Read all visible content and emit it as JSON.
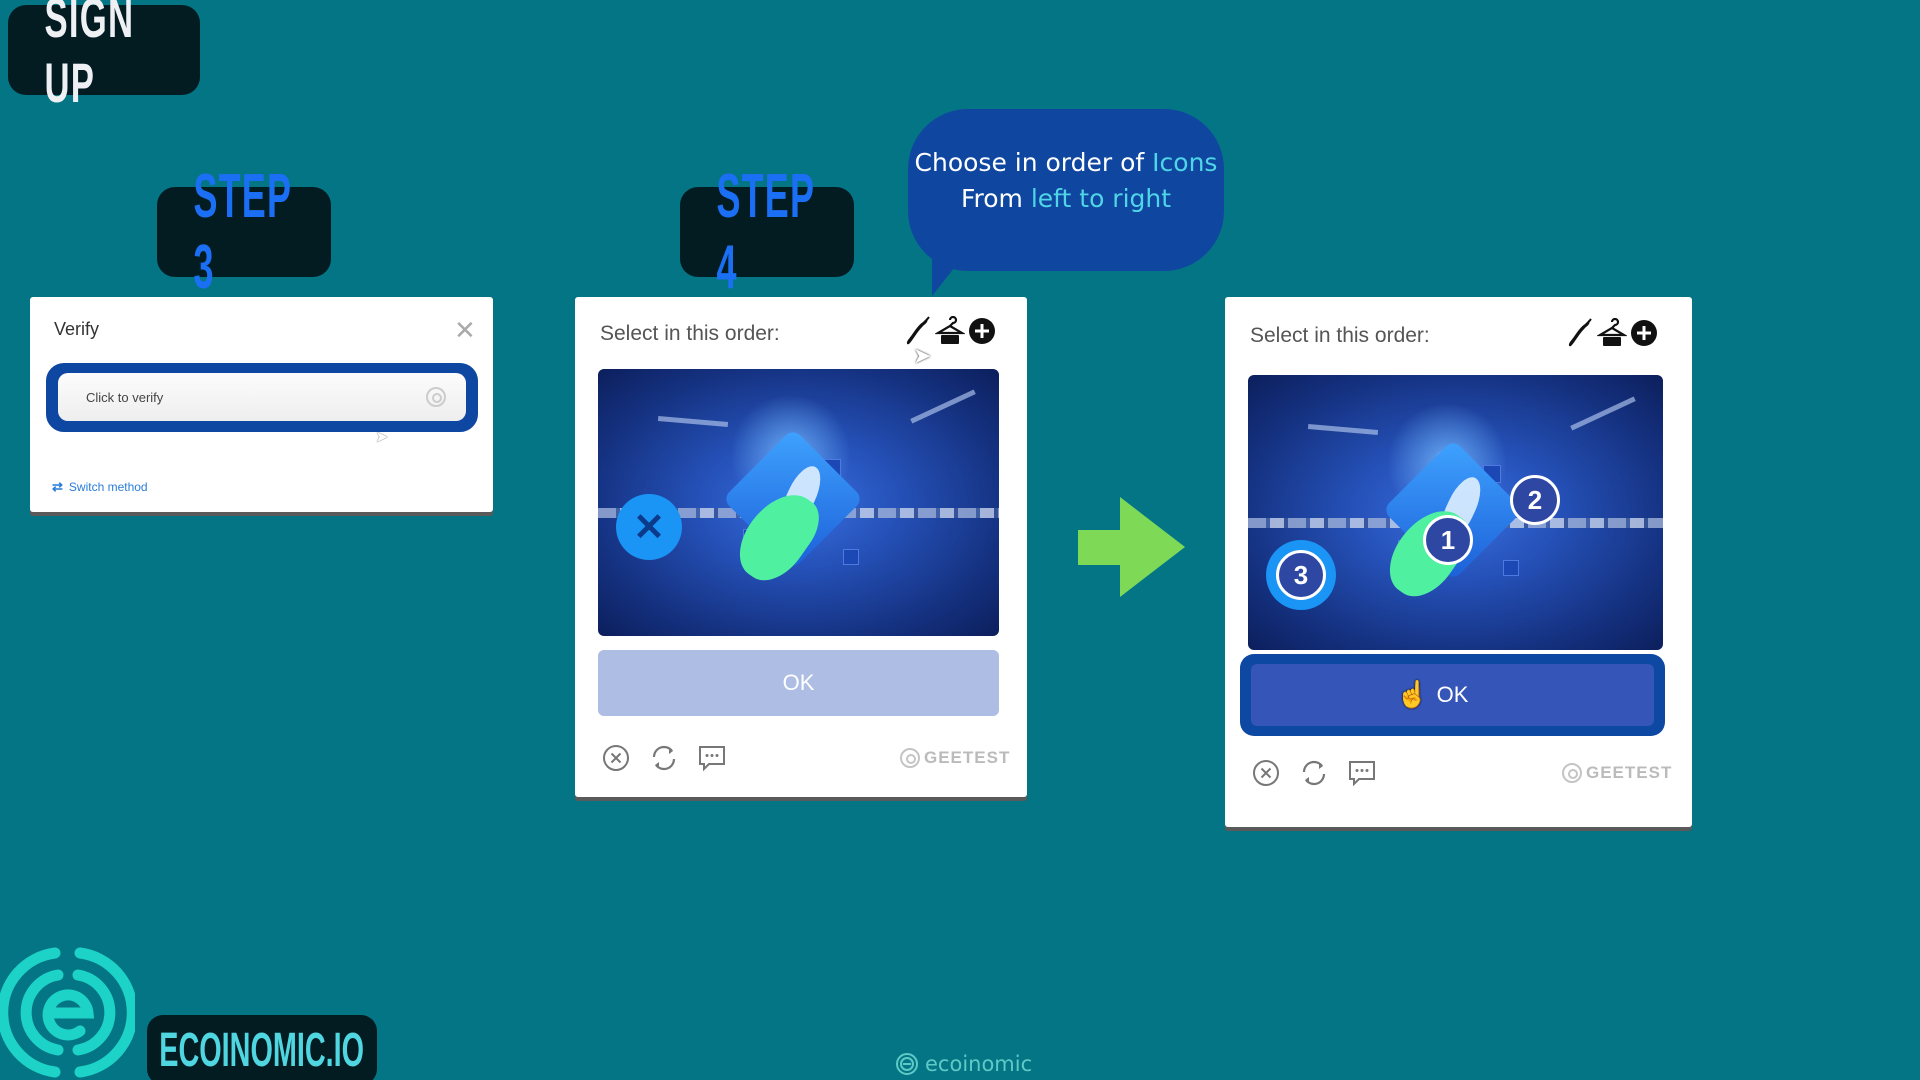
{
  "header": {
    "title": "SIGN UP"
  },
  "steps": [
    {
      "label": "STEP 3"
    },
    {
      "label": "STEP 4"
    }
  ],
  "tooltip": {
    "line1_text": "Choose in order of ",
    "line1_highlight": "Icons",
    "line2_text": "From ",
    "line2_highlight": "left to right"
  },
  "verify_dialog": {
    "title": "Verify",
    "close_icon": "close-icon",
    "field_label": "Click to verify",
    "switch_method": "Switch method"
  },
  "captcha_before": {
    "instruction": "Select in this order:",
    "icons": [
      "chili-pepper-icon",
      "hanger-icon",
      "plus-circle-icon"
    ],
    "ok_label": "OK",
    "ok_state": "disabled",
    "brand": "GEETEST"
  },
  "captcha_after": {
    "instruction": "Select in this order:",
    "icons": [
      "chili-pepper-icon",
      "hanger-icon",
      "plus-circle-icon"
    ],
    "markers": [
      "1",
      "2",
      "3"
    ],
    "ok_label": "OK",
    "ok_state": "active",
    "brand": "GEETEST"
  },
  "brand": {
    "name": "ECOINOMIC.IO",
    "watermark": "ecoinomic"
  },
  "colors": {
    "background": "#047585",
    "step_text": "#1b6ff5",
    "highlight": "#4fd5e6",
    "bubble": "#0f47a0",
    "arrow": "#7ed957",
    "ok_active": "#3556b8",
    "ok_disabled": "#aebde4"
  }
}
